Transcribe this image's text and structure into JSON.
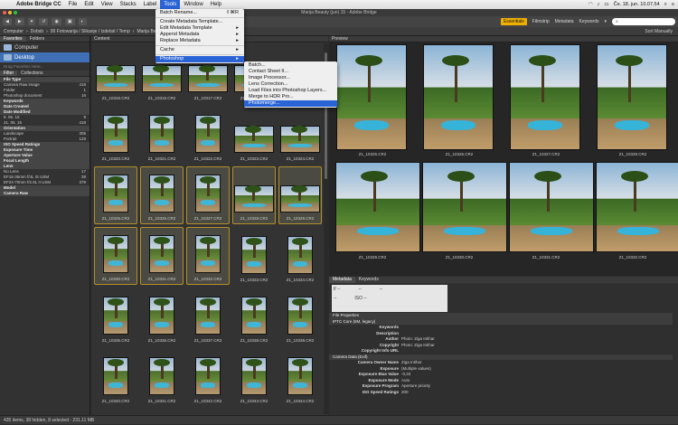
{
  "menubar": {
    "app_name": "Adobe Bridge CC",
    "items": [
      "File",
      "Edit",
      "View",
      "Stacks",
      "Label",
      "Tools",
      "Window",
      "Help"
    ],
    "clock": "Če. 18. jun. 10.07.54"
  },
  "window_title": "Marija Beauty (jun) 15 - Adobe Bridge",
  "tools_menu": {
    "items": [
      {
        "label": "Batch Rename...",
        "shortcut": "⇧⌘R",
        "arrow": ""
      },
      {
        "label": "Create Metadata Template...",
        "shortcut": "",
        "arrow": ""
      },
      {
        "label": "Edit Metadata Template",
        "shortcut": "",
        "arrow": "▸"
      },
      {
        "label": "Append Metadata",
        "shortcut": "",
        "arrow": "▸"
      },
      {
        "label": "Replace Metadata",
        "shortcut": "",
        "arrow": "▸"
      },
      {
        "label": "Cache",
        "shortcut": "",
        "arrow": "▸"
      },
      {
        "label": "Photoshop",
        "shortcut": "",
        "arrow": "▸"
      }
    ]
  },
  "photoshop_submenu": {
    "items": [
      {
        "label": "Batch..."
      },
      {
        "label": "Contact Sheet II..."
      },
      {
        "label": "Image Processor..."
      },
      {
        "label": "Lens Correction..."
      },
      {
        "label": "Load Files into Photoshop Layers..."
      },
      {
        "label": "Merge to HDR Pro..."
      },
      {
        "label": "Photomerge..."
      }
    ]
  },
  "toolbar": {
    "workspaces": [
      "Essentials",
      "Filmstrip",
      "Metadata",
      "Keywords"
    ],
    "search_placeholder": "⌕",
    "sort_label": "Sort Manually"
  },
  "pathbar": {
    "crumbs": [
      "Computer",
      "Dobsb",
      "00 Fotowarija / Slikanje / Izdelati / Temp",
      "Marija Beauty (jun) 15"
    ]
  },
  "left": {
    "tabs": [
      "Favorites",
      "Folders"
    ],
    "favorites": [
      "Computer",
      "Desktop"
    ],
    "drag_hint": "Drag Favorites Here...",
    "filter_tabs": [
      "Filter",
      "Collections"
    ],
    "filters": [
      {
        "label": "File Type",
        "count": "",
        "head": true
      },
      {
        "label": "Camera Raw image",
        "count": "418",
        "head": false
      },
      {
        "label": "Folder",
        "count": "1",
        "head": false
      },
      {
        "label": "Photoshop document",
        "count": "16",
        "head": false
      },
      {
        "label": "Keywords",
        "count": "",
        "head": true
      },
      {
        "label": "Date Created",
        "count": "",
        "head": true
      },
      {
        "label": "Date Modified",
        "count": "",
        "head": true
      },
      {
        "label": "8. 06. 15",
        "count": "9",
        "head": false
      },
      {
        "label": "31. 05. 15",
        "count": "418",
        "head": false
      },
      {
        "label": "Orientation",
        "count": "",
        "head": true
      },
      {
        "label": "Landscape",
        "count": "305",
        "head": false
      },
      {
        "label": "Portrait",
        "count": "129",
        "head": false
      },
      {
        "label": "ISO Speed Ratings",
        "count": "",
        "head": true
      },
      {
        "label": "Exposure Time",
        "count": "",
        "head": true
      },
      {
        "label": "Aperture Value",
        "count": "",
        "head": true
      },
      {
        "label": "Focal Length",
        "count": "",
        "head": true
      },
      {
        "label": "Lens",
        "count": "",
        "head": true
      },
      {
        "label": "No Lens",
        "count": "17",
        "head": false
      },
      {
        "label": "EF16-35mm f/4L IS USM",
        "count": "39",
        "head": false
      },
      {
        "label": "EF24-70mm f/2.8L II USM",
        "count": "379",
        "head": false
      },
      {
        "label": "Model",
        "count": "",
        "head": true
      },
      {
        "label": "Camera Raw",
        "count": "",
        "head": true
      }
    ]
  },
  "content": {
    "header": "Content",
    "thumbnails": [
      {
        "name": "Z1_10316.CR2",
        "sel": false,
        "portrait": false
      },
      {
        "name": "Z1_10316.CR2",
        "sel": false,
        "portrait": false
      },
      {
        "name": "Z1_10317.CR2",
        "sel": false,
        "portrait": false
      },
      {
        "name": "Z1_10318.CR2",
        "sel": false,
        "portrait": false
      },
      {
        "name": "Z1_10319.CR2",
        "sel": false,
        "portrait": false
      },
      {
        "name": "Z1_10320.CR2",
        "sel": false,
        "portrait": true
      },
      {
        "name": "Z1_10321.CR2",
        "sel": false,
        "portrait": true
      },
      {
        "name": "Z1_10322.CR2",
        "sel": false,
        "portrait": true
      },
      {
        "name": "Z1_10323.CR2",
        "sel": false,
        "portrait": false
      },
      {
        "name": "Z1_10324.CR2",
        "sel": false,
        "portrait": false
      },
      {
        "name": "Z1_10325.CR2",
        "sel": true,
        "portrait": true
      },
      {
        "name": "Z1_10326.CR2",
        "sel": true,
        "portrait": true
      },
      {
        "name": "Z1_10327.CR2",
        "sel": true,
        "portrait": true
      },
      {
        "name": "Z1_10328.CR2",
        "sel": true,
        "portrait": false
      },
      {
        "name": "Z1_10329.CR2",
        "sel": true,
        "portrait": false
      },
      {
        "name": "Z1_10330.CR2",
        "sel": true,
        "portrait": true
      },
      {
        "name": "Z1_10331.CR2",
        "sel": true,
        "portrait": true
      },
      {
        "name": "Z1_10332.CR2",
        "sel": true,
        "portrait": true
      },
      {
        "name": "Z1_10333.CR2",
        "sel": false,
        "portrait": true
      },
      {
        "name": "Z1_10334.CR2",
        "sel": false,
        "portrait": true
      },
      {
        "name": "Z1_10335.CR2",
        "sel": false,
        "portrait": true
      },
      {
        "name": "Z1_10336.CR2",
        "sel": false,
        "portrait": true
      },
      {
        "name": "Z1_10337.CR2",
        "sel": false,
        "portrait": true
      },
      {
        "name": "Z1_10338.CR2",
        "sel": false,
        "portrait": true
      },
      {
        "name": "Z1_10339.CR2",
        "sel": false,
        "portrait": true
      },
      {
        "name": "Z1_10340.CR2",
        "sel": false,
        "portrait": true
      },
      {
        "name": "Z1_10341.CR2",
        "sel": false,
        "portrait": true
      },
      {
        "name": "Z1_10342.CR2",
        "sel": false,
        "portrait": true
      },
      {
        "name": "Z1_10343.CR2",
        "sel": false,
        "portrait": true
      },
      {
        "name": "Z1_10344.CR2",
        "sel": false,
        "portrait": true
      }
    ]
  },
  "preview": {
    "header": "Preview",
    "images": [
      "Z1_10325.CR2",
      "Z1_10326.CR2",
      "Z1_10327.CR2",
      "Z1_10328.CR2",
      "Z1_10329.CR2",
      "Z1_10330.CR2",
      "Z1_10331.CR2",
      "Z1_10332.CR2"
    ]
  },
  "metadata": {
    "tabs": [
      "Metadata",
      "Keywords"
    ],
    "box_values": [
      "f/ --",
      "--",
      "--",
      "--",
      "ISO --"
    ],
    "sections": [
      {
        "title": "File Properties",
        "rows": []
      },
      {
        "title": "IPTC Core (IIM, legacy)",
        "rows": [
          {
            "k": "Keywords",
            "v": ""
          },
          {
            "k": "Description",
            "v": ""
          },
          {
            "k": "Author",
            "v": "Photo: Ziga Intihar"
          },
          {
            "k": "Copyright",
            "v": "Photo: Ziga Intihar"
          },
          {
            "k": "Copyright Info URL",
            "v": ""
          }
        ]
      },
      {
        "title": "Camera Data (Exif)",
        "rows": [
          {
            "k": "Camera Owner Name",
            "v": "Ziga Intihar"
          },
          {
            "k": "Exposure",
            "v": "(Multiple values)"
          },
          {
            "k": "Exposure Bias Value",
            "v": "-0,33"
          },
          {
            "k": "Exposure Mode",
            "v": "Auto"
          },
          {
            "k": "Exposure Program",
            "v": "Aperture priority"
          },
          {
            "k": "ISO Speed Ratings",
            "v": "200"
          }
        ]
      }
    ]
  },
  "status": "435 items, 38 hidden, 8 selected - 231.11 MB"
}
